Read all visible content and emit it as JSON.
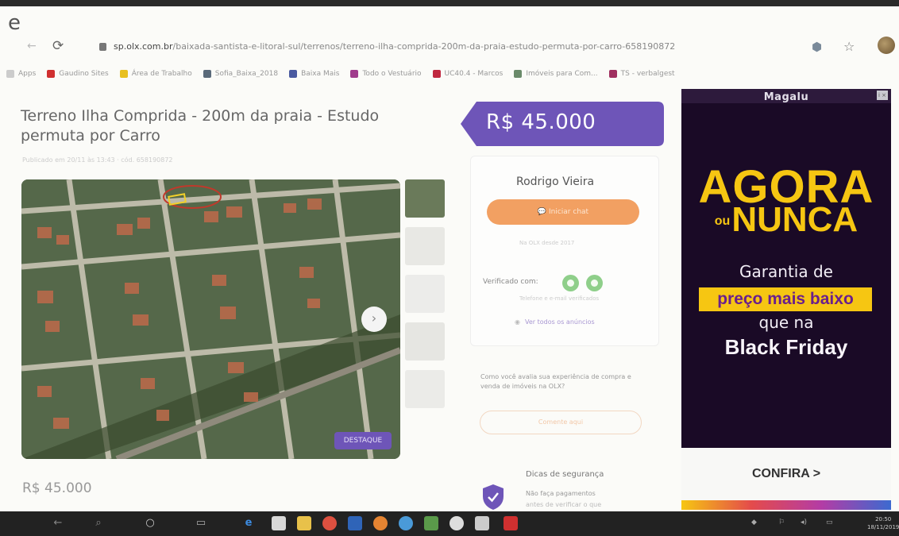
{
  "browser": {
    "top_glyph": "e",
    "url_domain": "sp.olx.com.br",
    "url_path": "/baixada-santista-e-litoral-sul/terrenos/terreno-ilha-comprida-200m-da-praia-estudo-permuta-por-carro-658190872"
  },
  "bookmarks": [
    {
      "label": "Apps",
      "color": "#cccccc"
    },
    {
      "label": "Gaudino Sites",
      "color": "#d03030"
    },
    {
      "label": "Área de Trabalho",
      "color": "#e8c020"
    },
    {
      "label": "Sofia_Baixa_2018",
      "color": "#5a6a7a"
    },
    {
      "label": "Baixa Mais",
      "color": "#4a5aa0"
    },
    {
      "label": "Todo o Vestuário",
      "color": "#a03c8c"
    },
    {
      "label": "UC40.4 - Marcos",
      "color": "#c02840"
    },
    {
      "label": "Imóveis para Com...",
      "color": "#6a8a6a"
    },
    {
      "label": "TS - verbalgest",
      "color": "#a03060"
    }
  ],
  "listing": {
    "title": "Terreno Ilha Comprida - 200m da praia - Estudo permuta por Carro",
    "published": "Publicado em 20/11 às 13:43 · cód. 658190872",
    "price": "R$ 45.000",
    "price_bottom": "R$ 45.000",
    "destaque_label": "DESTAQUE",
    "next_arrow": "›"
  },
  "seller": {
    "name": "Rodrigo Vieira",
    "chat_label": "Iniciar chat",
    "since": "Na OLX desde 2017",
    "verified_label": "Verificado com:",
    "verified_sub": "Telefone e e-mail verificados",
    "all_ads_label": "Ver todos os anúncios"
  },
  "survey": {
    "question": "Como você avalia sua experiência de compra e venda de imóveis na OLX?",
    "button_label": "Comente aqui"
  },
  "safety": {
    "title": "Dicas de segurança",
    "text": "Não faça pagamentos",
    "text2": "antes de verificar o que"
  },
  "ad": {
    "brand": "Magalu",
    "close": "i ×",
    "headline1": "AGORA",
    "headline2_small": "ou",
    "headline2": "NUNCA",
    "line1": "Garantia de",
    "highlight": "preço mais baixo",
    "line2": "que na",
    "line3": "Black Friday",
    "cta": "CONFIRA >"
  },
  "taskbar": {
    "tray_lang": "⚐",
    "clock_time": "20:50",
    "clock_date": "18/11/2019"
  }
}
